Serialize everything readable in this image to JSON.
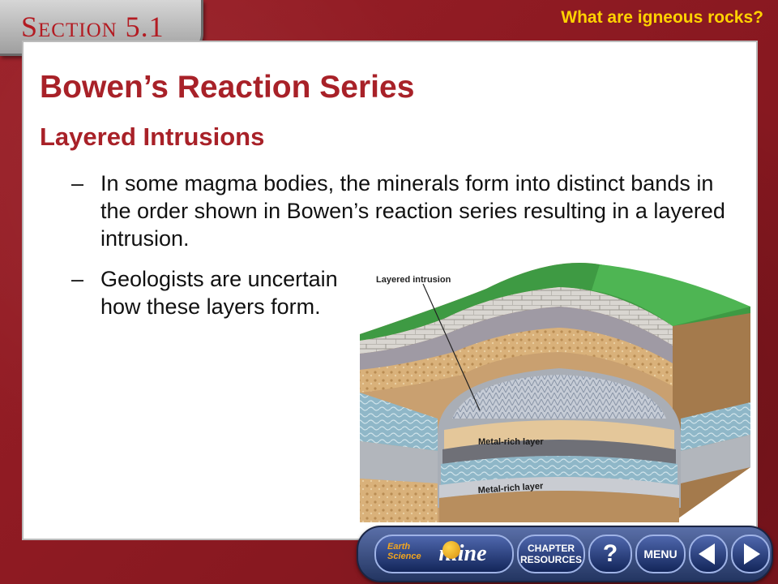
{
  "header": {
    "section_label": "Section 5.1",
    "question": "What are igneous rocks?"
  },
  "slide": {
    "title": "Bowen’s Reaction Series",
    "subtitle": "Layered Intrusions",
    "bullets": [
      {
        "dash": "–",
        "text": "In some magma bodies, the minerals form into distinct bands in the order shown in Bowen’s reaction series resulting in a layered intrusion."
      },
      {
        "dash": "–",
        "text": "Geologists are uncertain how these layers form."
      }
    ]
  },
  "diagram": {
    "label_intrusion": "Layered intrusion",
    "label_metal_1": "Metal-rich layer",
    "label_metal_2": "Metal-rich layer"
  },
  "nav": {
    "earth_science_1": "Earth",
    "earth_science_2": "Science",
    "online": "nline",
    "chapter_1": "CHAPTER",
    "chapter_2": "RESOURCES",
    "help": "?",
    "menu": "MENU"
  },
  "colors": {
    "background": "#8e1b22",
    "title": "#a82128",
    "question": "#ffd200",
    "nav": "#233561"
  }
}
